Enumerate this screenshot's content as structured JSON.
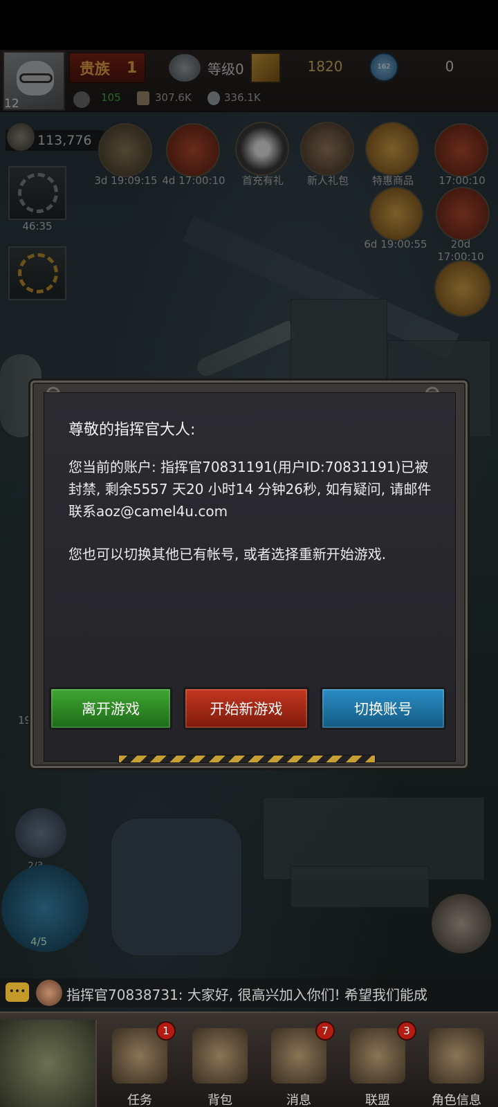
{
  "header": {
    "avatar_level": "12",
    "noble_label": "贵族",
    "noble_level": "1",
    "level_label": "等级0",
    "gold": "1820",
    "gem_label": "162",
    "gems": "0",
    "power": "105",
    "oil": "307.6K",
    "iron": "336.1K"
  },
  "left_panel": {
    "troops": "113,776",
    "build_timer": "46:35"
  },
  "events": [
    {
      "label": "3d 19:09:15"
    },
    {
      "label": "4d 17:00:10"
    },
    {
      "label": "首充有礼"
    },
    {
      "label": "新人礼包"
    },
    {
      "label": "特惠商品"
    },
    {
      "label": "17:00:10"
    },
    {
      "label": "6d 19:00:55"
    },
    {
      "label": "20d 17:00:10"
    }
  ],
  "dialog": {
    "greeting": "尊敬的指挥官大人:",
    "message": "您当前的账户: 指挥官70831191(用户ID:70831191)已被封禁, 剩余5557 天20 小时14 分钟26秒, 如有疑问, 请邮件联系aoz@camel4u.com",
    "message2": "您也可以切换其他已有帐号, 或者选择重新开始游戏.",
    "buttons": {
      "leave": "离开游戏",
      "new_game": "开始新游戏",
      "switch": "切换账号"
    }
  },
  "side_counters": {
    "count_a": "2/3",
    "count_b": "4/5",
    "partial": "19"
  },
  "chat": {
    "text": "指挥官70838731: 大家好, 很高兴加入你们! 希望我们能成"
  },
  "nav": {
    "items": [
      {
        "label": "任务",
        "badge": "1"
      },
      {
        "label": "背包",
        "badge": ""
      },
      {
        "label": "消息",
        "badge": "7"
      },
      {
        "label": "联盟",
        "badge": "3"
      },
      {
        "label": "角色信息",
        "badge": ""
      }
    ]
  }
}
